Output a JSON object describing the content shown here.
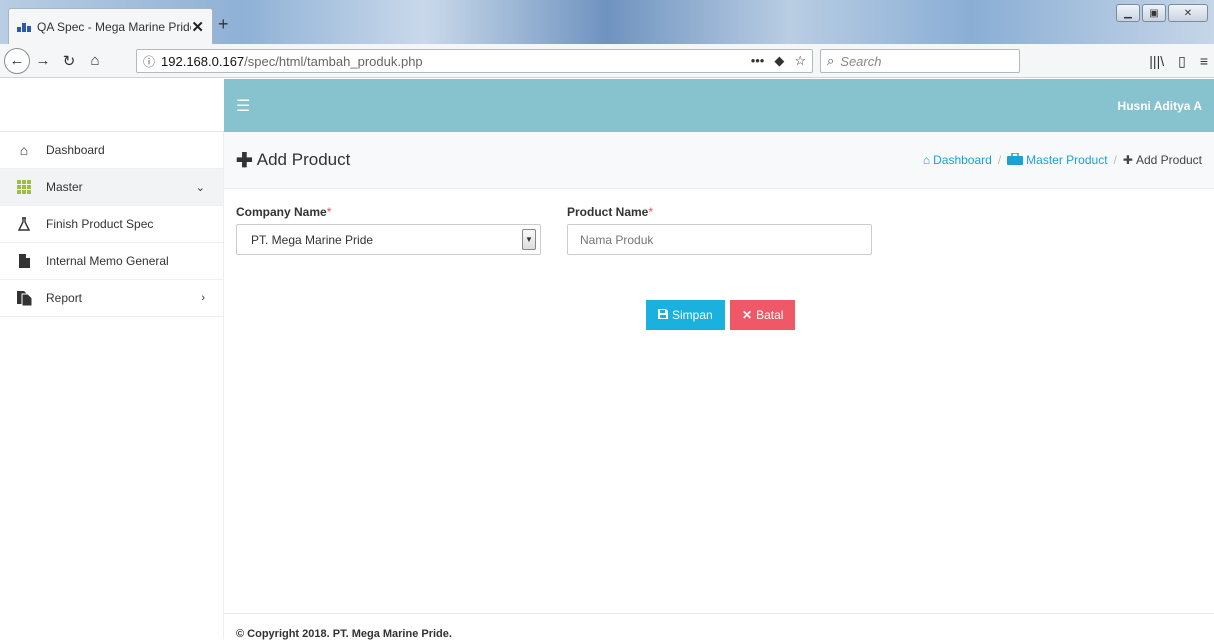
{
  "browser": {
    "tab_title": "QA Spec - Mega Marine Pride",
    "tab_close": "✕",
    "new_tab": "+",
    "url_host": "192.168.0.167",
    "url_path": "/spec/html/tambah_produk.php",
    "search_placeholder": "Search"
  },
  "header": {
    "user_name": "Husni Aditya A"
  },
  "sidebar": {
    "items": [
      {
        "label": "Dashboard",
        "icon": "home-icon"
      },
      {
        "label": "Master",
        "icon": "grid-icon"
      },
      {
        "label": "Finish Product Spec",
        "icon": "flask-icon"
      },
      {
        "label": "Internal Memo General",
        "icon": "document-icon"
      },
      {
        "label": "Report",
        "icon": "files-icon"
      }
    ]
  },
  "page": {
    "title": "Add Product",
    "breadcrumb": {
      "dashboard": "Dashboard",
      "master_product": "Master Product",
      "current": "Add Product"
    }
  },
  "form": {
    "company_label": "Company Name",
    "company_value": "PT. Mega Marine Pride",
    "product_label": "Product Name",
    "product_placeholder": "Nama Produk",
    "required_mark": "*",
    "save_label": "Simpan",
    "cancel_label": "Batal"
  },
  "footer": {
    "copyright": "© Copyright 2018. PT. Mega Marine Pride."
  },
  "colors": {
    "header_bg": "#86c3cf",
    "save_button": "#1ab1df",
    "cancel_button": "#ef5867",
    "link": "#1aa2d6"
  }
}
